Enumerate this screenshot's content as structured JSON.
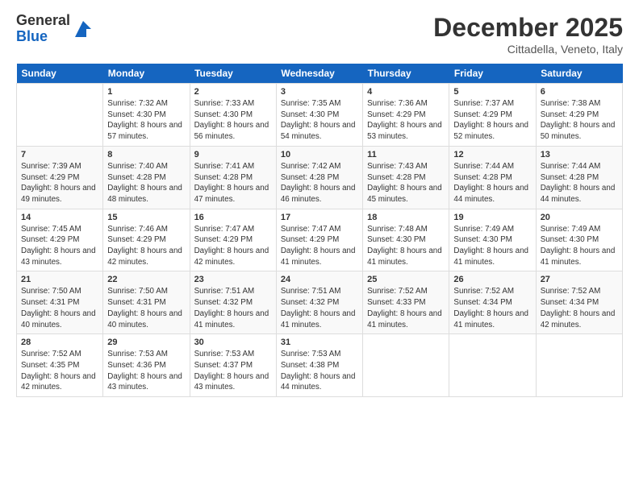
{
  "logo": {
    "general": "General",
    "blue": "Blue"
  },
  "title": "December 2025",
  "subtitle": "Cittadella, Veneto, Italy",
  "days_of_week": [
    "Sunday",
    "Monday",
    "Tuesday",
    "Wednesday",
    "Thursday",
    "Friday",
    "Saturday"
  ],
  "weeks": [
    [
      {
        "day": "",
        "sunrise": "",
        "sunset": "",
        "daylight": ""
      },
      {
        "day": "1",
        "sunrise": "Sunrise: 7:32 AM",
        "sunset": "Sunset: 4:30 PM",
        "daylight": "Daylight: 8 hours and 57 minutes."
      },
      {
        "day": "2",
        "sunrise": "Sunrise: 7:33 AM",
        "sunset": "Sunset: 4:30 PM",
        "daylight": "Daylight: 8 hours and 56 minutes."
      },
      {
        "day": "3",
        "sunrise": "Sunrise: 7:35 AM",
        "sunset": "Sunset: 4:30 PM",
        "daylight": "Daylight: 8 hours and 54 minutes."
      },
      {
        "day": "4",
        "sunrise": "Sunrise: 7:36 AM",
        "sunset": "Sunset: 4:29 PM",
        "daylight": "Daylight: 8 hours and 53 minutes."
      },
      {
        "day": "5",
        "sunrise": "Sunrise: 7:37 AM",
        "sunset": "Sunset: 4:29 PM",
        "daylight": "Daylight: 8 hours and 52 minutes."
      },
      {
        "day": "6",
        "sunrise": "Sunrise: 7:38 AM",
        "sunset": "Sunset: 4:29 PM",
        "daylight": "Daylight: 8 hours and 50 minutes."
      }
    ],
    [
      {
        "day": "7",
        "sunrise": "Sunrise: 7:39 AM",
        "sunset": "Sunset: 4:29 PM",
        "daylight": "Daylight: 8 hours and 49 minutes."
      },
      {
        "day": "8",
        "sunrise": "Sunrise: 7:40 AM",
        "sunset": "Sunset: 4:28 PM",
        "daylight": "Daylight: 8 hours and 48 minutes."
      },
      {
        "day": "9",
        "sunrise": "Sunrise: 7:41 AM",
        "sunset": "Sunset: 4:28 PM",
        "daylight": "Daylight: 8 hours and 47 minutes."
      },
      {
        "day": "10",
        "sunrise": "Sunrise: 7:42 AM",
        "sunset": "Sunset: 4:28 PM",
        "daylight": "Daylight: 8 hours and 46 minutes."
      },
      {
        "day": "11",
        "sunrise": "Sunrise: 7:43 AM",
        "sunset": "Sunset: 4:28 PM",
        "daylight": "Daylight: 8 hours and 45 minutes."
      },
      {
        "day": "12",
        "sunrise": "Sunrise: 7:44 AM",
        "sunset": "Sunset: 4:28 PM",
        "daylight": "Daylight: 8 hours and 44 minutes."
      },
      {
        "day": "13",
        "sunrise": "Sunrise: 7:44 AM",
        "sunset": "Sunset: 4:28 PM",
        "daylight": "Daylight: 8 hours and 44 minutes."
      }
    ],
    [
      {
        "day": "14",
        "sunrise": "Sunrise: 7:45 AM",
        "sunset": "Sunset: 4:29 PM",
        "daylight": "Daylight: 8 hours and 43 minutes."
      },
      {
        "day": "15",
        "sunrise": "Sunrise: 7:46 AM",
        "sunset": "Sunset: 4:29 PM",
        "daylight": "Daylight: 8 hours and 42 minutes."
      },
      {
        "day": "16",
        "sunrise": "Sunrise: 7:47 AM",
        "sunset": "Sunset: 4:29 PM",
        "daylight": "Daylight: 8 hours and 42 minutes."
      },
      {
        "day": "17",
        "sunrise": "Sunrise: 7:47 AM",
        "sunset": "Sunset: 4:29 PM",
        "daylight": "Daylight: 8 hours and 41 minutes."
      },
      {
        "day": "18",
        "sunrise": "Sunrise: 7:48 AM",
        "sunset": "Sunset: 4:30 PM",
        "daylight": "Daylight: 8 hours and 41 minutes."
      },
      {
        "day": "19",
        "sunrise": "Sunrise: 7:49 AM",
        "sunset": "Sunset: 4:30 PM",
        "daylight": "Daylight: 8 hours and 41 minutes."
      },
      {
        "day": "20",
        "sunrise": "Sunrise: 7:49 AM",
        "sunset": "Sunset: 4:30 PM",
        "daylight": "Daylight: 8 hours and 41 minutes."
      }
    ],
    [
      {
        "day": "21",
        "sunrise": "Sunrise: 7:50 AM",
        "sunset": "Sunset: 4:31 PM",
        "daylight": "Daylight: 8 hours and 40 minutes."
      },
      {
        "day": "22",
        "sunrise": "Sunrise: 7:50 AM",
        "sunset": "Sunset: 4:31 PM",
        "daylight": "Daylight: 8 hours and 40 minutes."
      },
      {
        "day": "23",
        "sunrise": "Sunrise: 7:51 AM",
        "sunset": "Sunset: 4:32 PM",
        "daylight": "Daylight: 8 hours and 41 minutes."
      },
      {
        "day": "24",
        "sunrise": "Sunrise: 7:51 AM",
        "sunset": "Sunset: 4:32 PM",
        "daylight": "Daylight: 8 hours and 41 minutes."
      },
      {
        "day": "25",
        "sunrise": "Sunrise: 7:52 AM",
        "sunset": "Sunset: 4:33 PM",
        "daylight": "Daylight: 8 hours and 41 minutes."
      },
      {
        "day": "26",
        "sunrise": "Sunrise: 7:52 AM",
        "sunset": "Sunset: 4:34 PM",
        "daylight": "Daylight: 8 hours and 41 minutes."
      },
      {
        "day": "27",
        "sunrise": "Sunrise: 7:52 AM",
        "sunset": "Sunset: 4:34 PM",
        "daylight": "Daylight: 8 hours and 42 minutes."
      }
    ],
    [
      {
        "day": "28",
        "sunrise": "Sunrise: 7:52 AM",
        "sunset": "Sunset: 4:35 PM",
        "daylight": "Daylight: 8 hours and 42 minutes."
      },
      {
        "day": "29",
        "sunrise": "Sunrise: 7:53 AM",
        "sunset": "Sunset: 4:36 PM",
        "daylight": "Daylight: 8 hours and 43 minutes."
      },
      {
        "day": "30",
        "sunrise": "Sunrise: 7:53 AM",
        "sunset": "Sunset: 4:37 PM",
        "daylight": "Daylight: 8 hours and 43 minutes."
      },
      {
        "day": "31",
        "sunrise": "Sunrise: 7:53 AM",
        "sunset": "Sunset: 4:38 PM",
        "daylight": "Daylight: 8 hours and 44 minutes."
      },
      {
        "day": "",
        "sunrise": "",
        "sunset": "",
        "daylight": ""
      },
      {
        "day": "",
        "sunrise": "",
        "sunset": "",
        "daylight": ""
      },
      {
        "day": "",
        "sunrise": "",
        "sunset": "",
        "daylight": ""
      }
    ]
  ]
}
